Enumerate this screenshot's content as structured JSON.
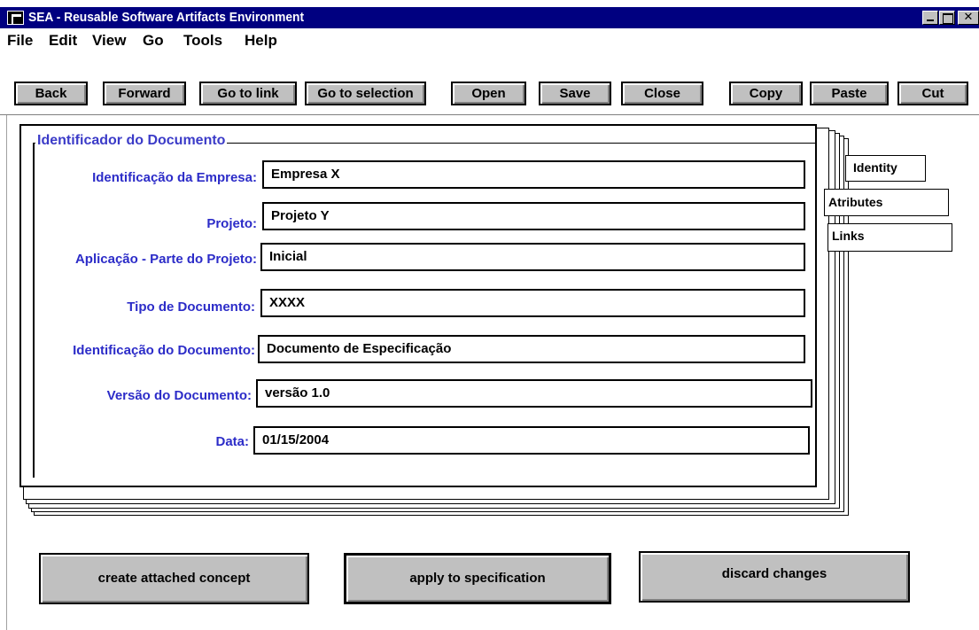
{
  "window": {
    "title": "SEA - Reusable Software Artifacts Environment"
  },
  "menu": [
    "File",
    "Edit",
    "View",
    "Go",
    "Tools",
    "Help"
  ],
  "toolbar": [
    "Back",
    "Forward",
    "Go to link",
    "Go to selection",
    "Open",
    "Save",
    "Close",
    "Copy",
    "Paste",
    "Cut"
  ],
  "group": {
    "title": "Identificador do Documento"
  },
  "fields": [
    {
      "label": "Identificação da Empresa:",
      "value": "Empresa X"
    },
    {
      "label": "Projeto:",
      "value": "Projeto Y"
    },
    {
      "label": "Aplicação - Parte do Projeto:",
      "value": "Inicial"
    },
    {
      "label": "Tipo de Documento:",
      "value": "XXXX"
    },
    {
      "label": "Identificação do Documento:",
      "value": "Documento de Especificação"
    },
    {
      "label": "Versão do Documento:",
      "value": "versão 1.0"
    },
    {
      "label": "Data:",
      "value": "01/15/2004"
    }
  ],
  "tabs": [
    "Identity",
    "Atributes",
    "Links"
  ],
  "actions": [
    "create attached concept",
    "apply to specification",
    "discard changes"
  ]
}
